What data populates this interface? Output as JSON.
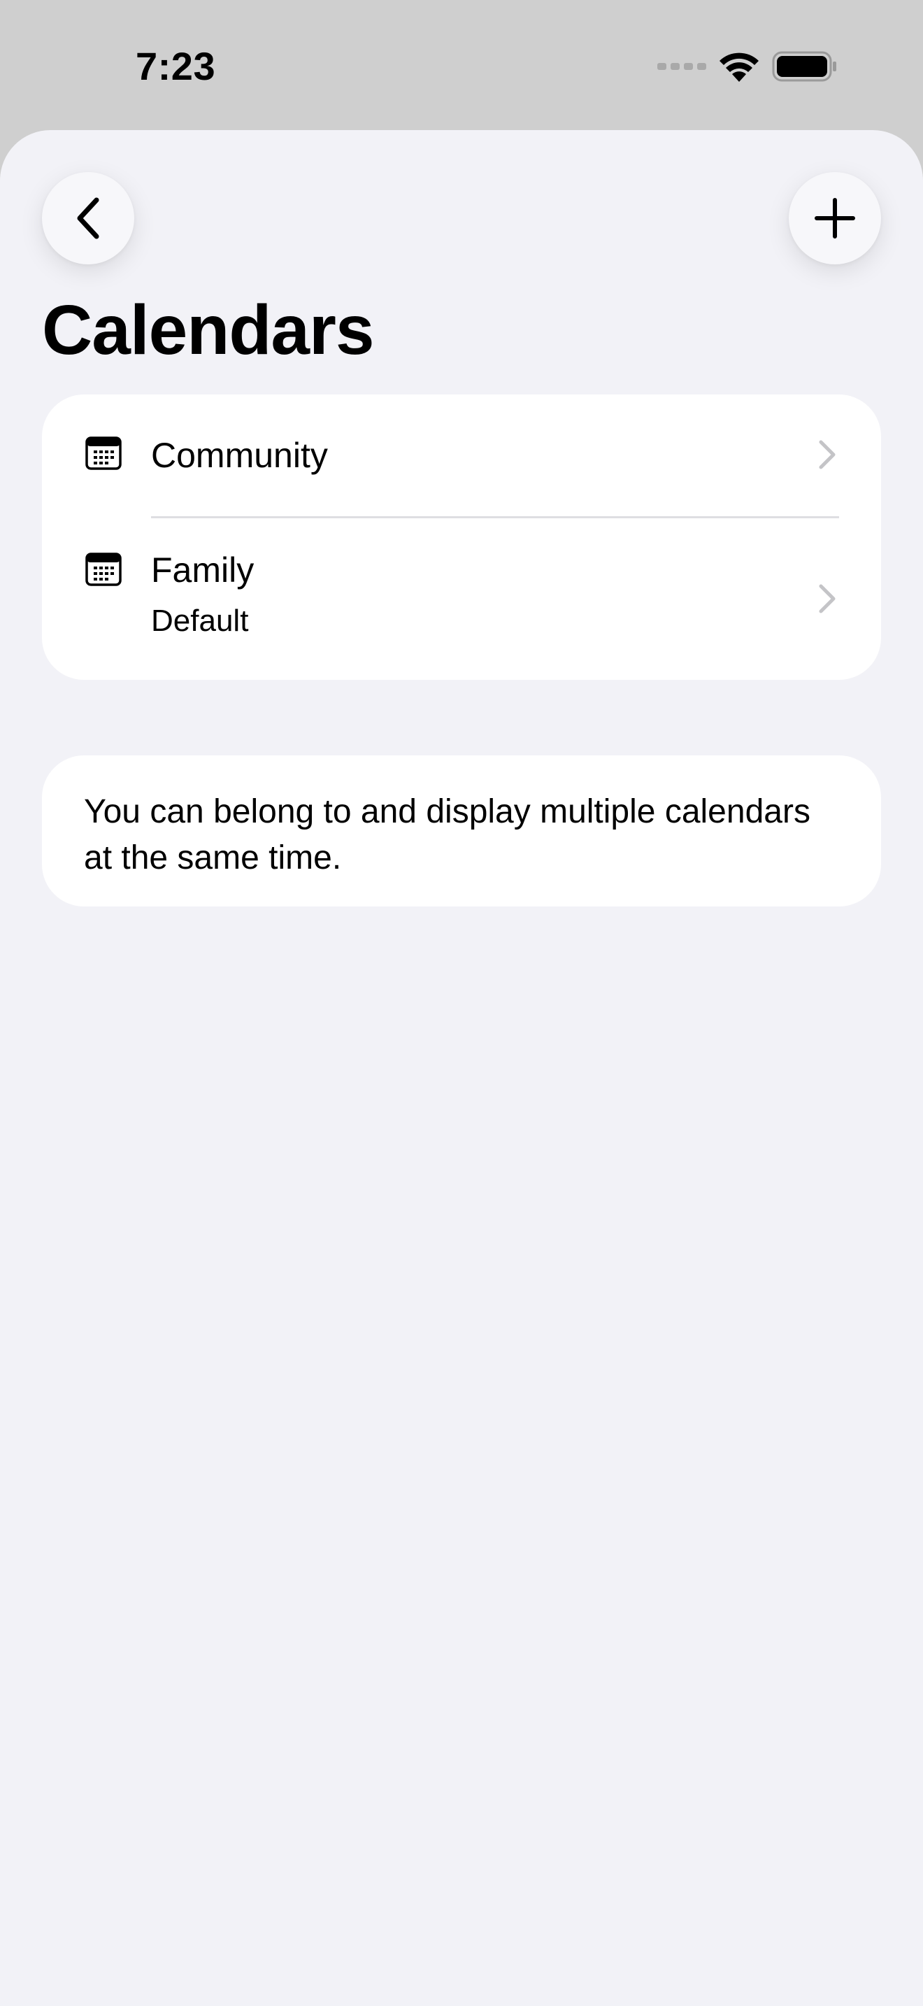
{
  "status_bar": {
    "time": "7:23",
    "icons": [
      "cellular-signal-icon",
      "wifi-icon",
      "battery-icon"
    ]
  },
  "header": {
    "back_icon": "chevron-left-icon",
    "add_icon": "plus-icon"
  },
  "page": {
    "title": "Calendars"
  },
  "calendars": {
    "items": [
      {
        "label": "Community",
        "sublabel": "",
        "icon": "calendar-icon"
      },
      {
        "label": "Family",
        "sublabel": "Default",
        "icon": "calendar-icon"
      }
    ]
  },
  "info": {
    "text": "You can belong to and display multiple calendars at the same time."
  },
  "colors": {
    "status_bar_bg": "#cfcfcf",
    "sheet_bg": "#f2f2f7",
    "card_bg": "#ffffff",
    "chevron": "#c4c4c7",
    "divider": "#dedee2"
  }
}
